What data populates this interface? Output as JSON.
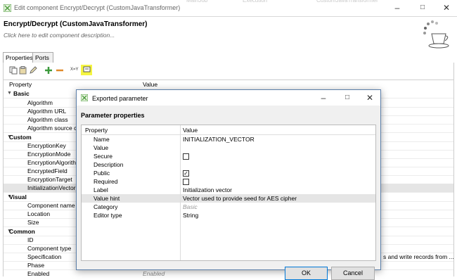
{
  "window": {
    "title": "Edit component Encrypt/Decrypt (CustomJavaTransformer)",
    "background_fragments": [
      "MainJob",
      "Execution",
      "CustomJavaTransformer"
    ]
  },
  "header": {
    "title": "Encrypt/Decrypt (CustomJavaTransformer)",
    "description_placeholder": "Click here to edit component description..."
  },
  "tabs": [
    {
      "label": "Properties",
      "active": true
    },
    {
      "label": "Ports",
      "active": false
    }
  ],
  "toolbar": {
    "icons": [
      "copy-icon",
      "paste-icon",
      "edit-icon",
      "add-icon",
      "remove-icon",
      "xml-icon",
      "export-parameter-icon"
    ],
    "x_label": "X=Y"
  },
  "grid": {
    "col_property": "Property",
    "col_value": "Value",
    "categories": {
      "basic": "Basic",
      "custom": "Custom",
      "visual": "Visual",
      "common": "Common"
    },
    "basic_items": [
      "Algorithm",
      "Algorithm URL",
      "Algorithm class",
      "Algorithm source cl"
    ],
    "custom_items": [
      "EncryptionKey",
      "EncryptionMode",
      "EncryptionAlgorithm",
      "EncryptedField",
      "EncryptionTarget",
      "InitializationVector"
    ],
    "visual_items": [
      "Component name",
      "Location",
      "Size"
    ],
    "common_items": [
      "ID",
      "Component type",
      "Specification",
      "Phase",
      "Enabled"
    ],
    "spec_value_fragment": "s and write records from ...",
    "enabled_value": "Enabled"
  },
  "dialog": {
    "title": "Exported parameter",
    "section_title": "Parameter properties",
    "col_property": "Property",
    "col_value": "Value",
    "rows": [
      {
        "name": "Name",
        "value": "INITIALIZATION_VECTOR"
      },
      {
        "name": "Value",
        "value": ""
      },
      {
        "name": "Secure",
        "checkbox": false
      },
      {
        "name": "Description",
        "value": ""
      },
      {
        "name": "Public",
        "checkbox": true
      },
      {
        "name": "Required",
        "checkbox": false
      },
      {
        "name": "Label",
        "value": "Initialization vector"
      },
      {
        "name": "Value hint",
        "value": "Vector used to provide seed for AES cipher"
      },
      {
        "name": "Category",
        "value": "Basic"
      },
      {
        "name": "Editor type",
        "value": "String"
      }
    ],
    "ok_label": "OK",
    "cancel_label": "Cancel"
  },
  "colors": {
    "accent_green": "#3c9a3c",
    "selection": "#e5e5e5",
    "highlight_yellow": "#f5f542"
  }
}
